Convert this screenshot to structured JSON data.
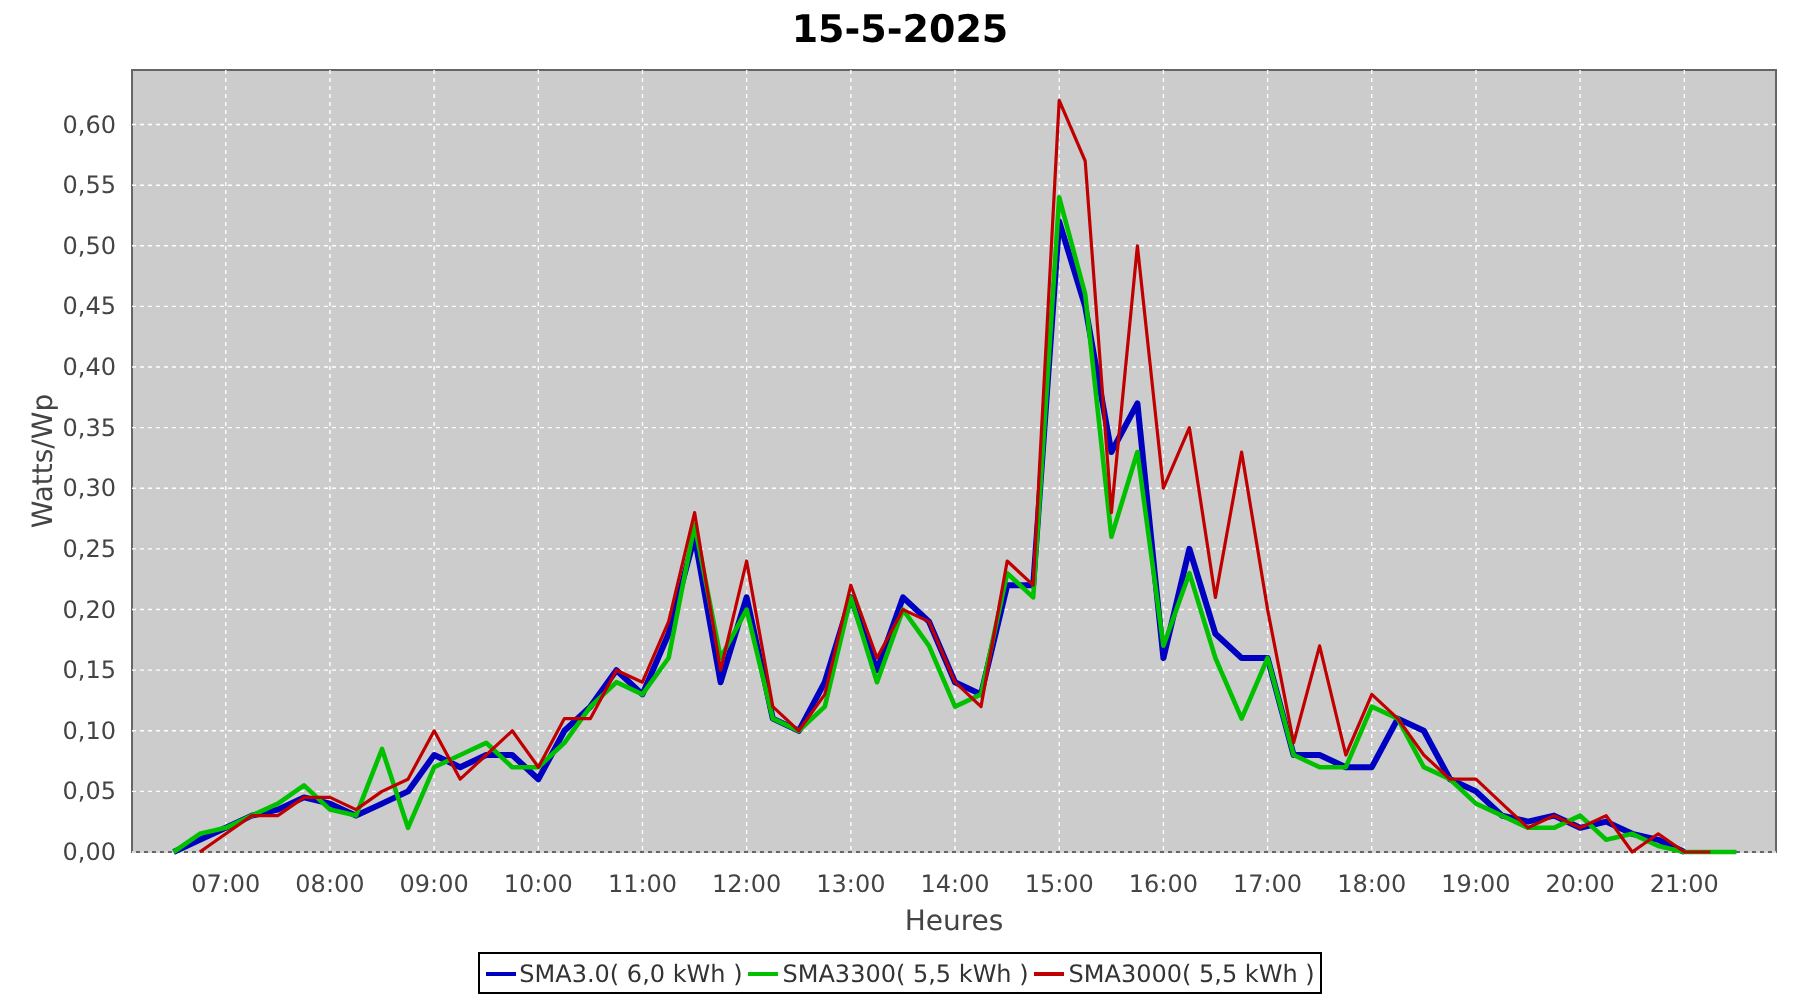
{
  "title": "15-5-2025",
  "chart_data": {
    "type": "line",
    "xlabel": "Heures",
    "ylabel": "Watts/Wp",
    "x": [
      6.5,
      6.75,
      7,
      7.25,
      7.5,
      7.75,
      8,
      8.25,
      8.5,
      8.75,
      9,
      9.25,
      9.5,
      9.75,
      10,
      10.25,
      10.5,
      10.75,
      11,
      11.25,
      11.5,
      11.75,
      12,
      12.25,
      12.5,
      12.75,
      13,
      13.25,
      13.5,
      13.75,
      14,
      14.25,
      14.5,
      14.75,
      15,
      15.25,
      15.5,
      15.75,
      16,
      16.25,
      16.5,
      16.75,
      17,
      17.25,
      17.5,
      17.75,
      18,
      18.25,
      18.5,
      18.75,
      19,
      19.25,
      19.5,
      19.75,
      20,
      20.25,
      20.5,
      20.75,
      21,
      21.25,
      21.5
    ],
    "grid": true,
    "xlim": [
      6.1,
      21.88
    ],
    "ylim": [
      0,
      0.645
    ],
    "xticks": [
      {
        "value": 7,
        "label": "07:00"
      },
      {
        "value": 8,
        "label": "08:00"
      },
      {
        "value": 9,
        "label": "09:00"
      },
      {
        "value": 10,
        "label": "10:00"
      },
      {
        "value": 11,
        "label": "11:00"
      },
      {
        "value": 12,
        "label": "12:00"
      },
      {
        "value": 13,
        "label": "13:00"
      },
      {
        "value": 14,
        "label": "14:00"
      },
      {
        "value": 15,
        "label": "15:00"
      },
      {
        "value": 16,
        "label": "16:00"
      },
      {
        "value": 17,
        "label": "17:00"
      },
      {
        "value": 18,
        "label": "18:00"
      },
      {
        "value": 19,
        "label": "19:00"
      },
      {
        "value": 20,
        "label": "20:00"
      },
      {
        "value": 21,
        "label": "21:00"
      }
    ],
    "yticks": [
      {
        "value": 0,
        "label": "0,00"
      },
      {
        "value": 0.05,
        "label": "0,05"
      },
      {
        "value": 0.1,
        "label": "0,10"
      },
      {
        "value": 0.15,
        "label": "0,15"
      },
      {
        "value": 0.2,
        "label": "0,20"
      },
      {
        "value": 0.25,
        "label": "0,25"
      },
      {
        "value": 0.3,
        "label": "0,30"
      },
      {
        "value": 0.35,
        "label": "0,35"
      },
      {
        "value": 0.4,
        "label": "0,40"
      },
      {
        "value": 0.45,
        "label": "0,45"
      },
      {
        "value": 0.5,
        "label": "0,50"
      },
      {
        "value": 0.55,
        "label": "0,55"
      },
      {
        "value": 0.6,
        "label": "0,60"
      }
    ],
    "series": [
      {
        "name": "SMA3.0( 6,0 kWh )",
        "color": "#0000c0",
        "values": [
          0,
          0.01,
          0.02,
          0.03,
          0.035,
          0.045,
          0.04,
          0.03,
          0.04,
          0.05,
          0.08,
          0.07,
          0.08,
          0.08,
          0.06,
          0.1,
          0.12,
          0.15,
          0.13,
          0.18,
          0.26,
          0.14,
          0.21,
          0.11,
          0.1,
          0.14,
          0.21,
          0.15,
          0.21,
          0.19,
          0.14,
          0.13,
          0.22,
          0.22,
          0.52,
          0.45,
          0.33,
          0.37,
          0.16,
          0.25,
          0.18,
          0.16,
          0.16,
          0.08,
          0.08,
          0.07,
          0.07,
          0.11,
          0.1,
          0.06,
          0.05,
          0.03,
          0.025,
          0.03,
          0.02,
          0.025,
          0.015,
          0.01,
          0,
          null,
          null
        ]
      },
      {
        "name": "SMA3300( 5,5 kWh )",
        "color": "#00c000",
        "values": [
          0,
          0.015,
          0.02,
          0.03,
          0.04,
          0.055,
          0.035,
          0.03,
          0.085,
          0.02,
          0.07,
          0.08,
          0.09,
          0.07,
          0.07,
          0.09,
          0.12,
          0.14,
          0.13,
          0.16,
          0.27,
          0.16,
          0.2,
          0.11,
          0.1,
          0.12,
          0.21,
          0.14,
          0.2,
          0.17,
          0.12,
          0.13,
          0.23,
          0.21,
          0.54,
          0.46,
          0.26,
          0.33,
          0.17,
          0.23,
          0.16,
          0.11,
          0.16,
          0.08,
          0.07,
          0.07,
          0.12,
          0.11,
          0.07,
          0.06,
          0.04,
          0.03,
          0.02,
          0.02,
          0.03,
          0.01,
          0.015,
          0.005,
          0,
          0,
          0
        ]
      },
      {
        "name": "SMA3000( 5,5 kWh )",
        "color": "#c00000",
        "values": [
          null,
          0,
          0.015,
          0.03,
          0.03,
          0.045,
          0.045,
          0.035,
          0.05,
          0.06,
          0.1,
          0.06,
          0.08,
          0.1,
          0.07,
          0.11,
          0.11,
          0.15,
          0.14,
          0.19,
          0.28,
          0.15,
          0.24,
          0.12,
          0.1,
          0.13,
          0.22,
          0.16,
          0.2,
          0.19,
          0.14,
          0.12,
          0.24,
          0.22,
          0.62,
          0.57,
          0.28,
          0.5,
          0.3,
          0.35,
          0.21,
          0.33,
          0.2,
          0.09,
          0.17,
          0.08,
          0.13,
          0.11,
          0.08,
          0.06,
          0.06,
          0.04,
          0.02,
          0.03,
          0.02,
          0.03,
          0,
          0.015,
          0,
          0,
          null
        ]
      }
    ]
  }
}
